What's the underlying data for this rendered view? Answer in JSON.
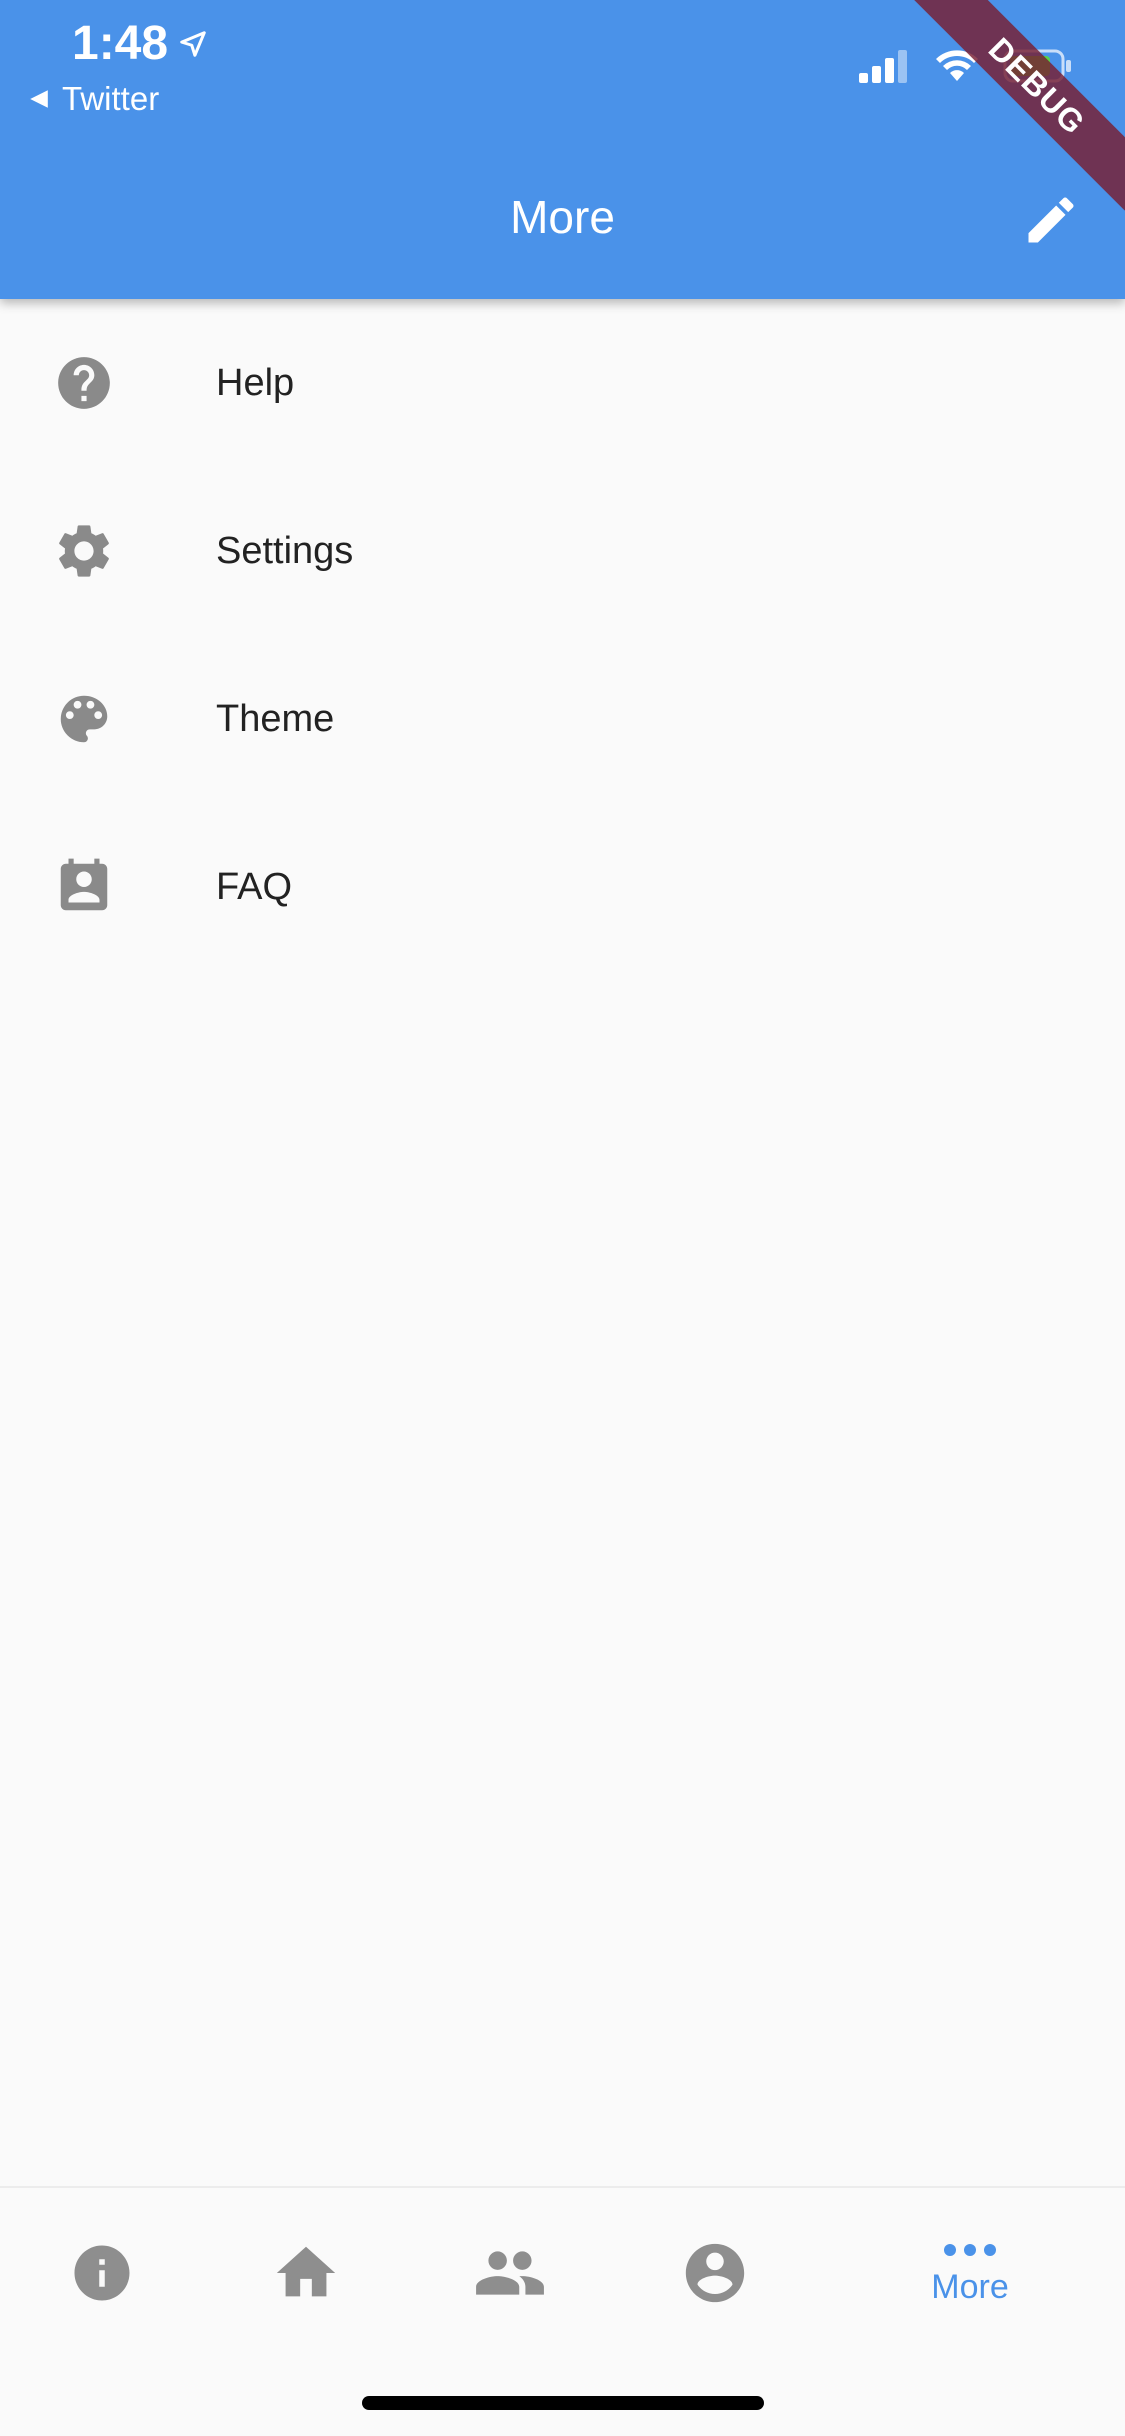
{
  "status_bar": {
    "time": "1:48",
    "back_app": "Twitter"
  },
  "debug_banner": "DEBUG",
  "app_bar": {
    "title": "More",
    "color": "#4a92e9"
  },
  "list": [
    {
      "label": "Help",
      "icon": "help-circle-icon"
    },
    {
      "label": "Settings",
      "icon": "gear-icon"
    },
    {
      "label": "Theme",
      "icon": "palette-icon"
    },
    {
      "label": "FAQ",
      "icon": "contact-card-icon"
    }
  ],
  "bottom_nav": {
    "items": [
      {
        "icon": "info-icon",
        "label": ""
      },
      {
        "icon": "home-icon",
        "label": ""
      },
      {
        "icon": "people-icon",
        "label": ""
      },
      {
        "icon": "account-circle-icon",
        "label": ""
      },
      {
        "icon": "more-horizontal-icon",
        "label": "More",
        "active": true
      }
    ],
    "active_color": "#4a92e9",
    "inactive_color": "#8e8e8e"
  }
}
